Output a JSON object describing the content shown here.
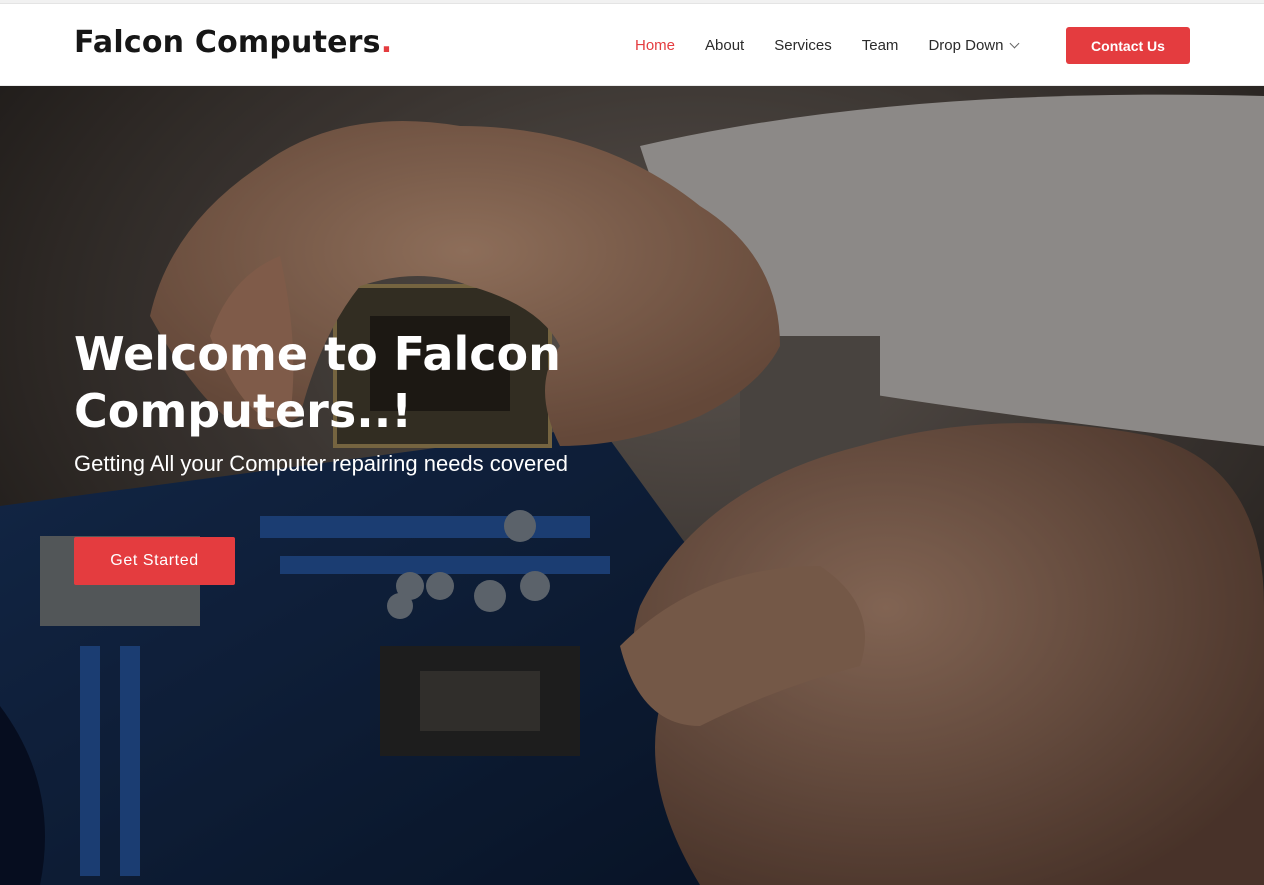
{
  "brand": {
    "name": "Falcon Computers",
    "dot": ".",
    "accent_color": "#e43c3f"
  },
  "nav": {
    "items": [
      {
        "label": "Home",
        "active": true
      },
      {
        "label": "About",
        "active": false
      },
      {
        "label": "Services",
        "active": false
      },
      {
        "label": "Team",
        "active": false
      },
      {
        "label": "Drop Down",
        "active": false,
        "icon": "chevron-down-icon"
      }
    ],
    "contact_label": "Contact Us"
  },
  "hero": {
    "title": "Welcome to Falcon Computers..!",
    "subtitle": "Getting All your Computer repairing needs covered",
    "cta_label": "Get Started",
    "background": "photo-hands-installing-cpu-on-motherboard"
  }
}
